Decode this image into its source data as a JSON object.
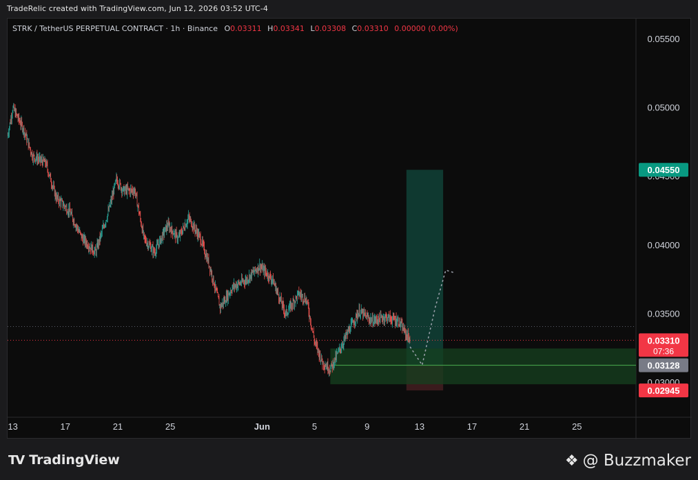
{
  "header": {
    "credit": "TradeRelic created with TradingView.com, Jun 12, 2026 03:52 UTC-4"
  },
  "legend": {
    "symbol": "STRK / TetherUS PERPETUAL CONTRACT · 1h · Binance",
    "o_label": "O",
    "o_value": "0.03311",
    "h_label": "H",
    "h_value": "0.03341",
    "l_label": "L",
    "l_value": "0.03308",
    "c_label": "C",
    "c_value": "0.03310",
    "change": "0.00000 (0.00%)"
  },
  "footer": {
    "brand_mark": "TV",
    "brand": "TradingView",
    "author": "@ Buzzmaker"
  },
  "colors": {
    "up": "#26a69a",
    "down": "#ef5350",
    "target_fill": "#103c33",
    "stop_fill": "#3d1c1f",
    "entry_zone": "#16401f",
    "current_price": "#f23645",
    "target_label": "#089981",
    "entry_label": "#787b86"
  },
  "chart_data": {
    "type": "candlestick",
    "y_axis": {
      "min": 0.0275,
      "max": 0.0565,
      "tick_labels": [
        "0.05500",
        "0.05000",
        "0.04500",
        "0.04000",
        "0.03500",
        "0.03000"
      ]
    },
    "x_axis": {
      "tick_labels": [
        "13",
        "17",
        "21",
        "25",
        "Jun",
        "5",
        "9",
        "13",
        "17",
        "21",
        "25"
      ],
      "tick_days": [
        13,
        17,
        21,
        25,
        32,
        36,
        40,
        44,
        48,
        52,
        56
      ],
      "start_day": 12.6,
      "end_day": 60.5
    },
    "price_path": [
      [
        12.6,
        0.048
      ],
      [
        13.0,
        0.05
      ],
      [
        13.8,
        0.0485
      ],
      [
        14.5,
        0.0465
      ],
      [
        15.5,
        0.046
      ],
      [
        16.3,
        0.0435
      ],
      [
        17.3,
        0.0425
      ],
      [
        18.3,
        0.0405
      ],
      [
        19.3,
        0.0395
      ],
      [
        20.3,
        0.0425
      ],
      [
        20.9,
        0.0448
      ],
      [
        21.4,
        0.044
      ],
      [
        22.3,
        0.044
      ],
      [
        23.0,
        0.0405
      ],
      [
        23.8,
        0.0395
      ],
      [
        24.8,
        0.0415
      ],
      [
        25.6,
        0.0405
      ],
      [
        26.4,
        0.042
      ],
      [
        27.3,
        0.0405
      ],
      [
        28.0,
        0.0385
      ],
      [
        28.8,
        0.0355
      ],
      [
        29.8,
        0.037
      ],
      [
        30.8,
        0.0375
      ],
      [
        31.8,
        0.0385
      ],
      [
        32.8,
        0.0375
      ],
      [
        33.8,
        0.035
      ],
      [
        34.8,
        0.0365
      ],
      [
        35.4,
        0.036
      ],
      [
        36.0,
        0.033
      ],
      [
        36.6,
        0.0315
      ],
      [
        37.2,
        0.031
      ],
      [
        37.8,
        0.0322
      ],
      [
        38.6,
        0.0338
      ],
      [
        39.4,
        0.0352
      ],
      [
        40.4,
        0.0345
      ],
      [
        41.4,
        0.0348
      ],
      [
        42.4,
        0.0345
      ],
      [
        43.0,
        0.0335
      ],
      [
        43.3,
        0.0331
      ]
    ],
    "current_price": 0.0331,
    "current_price_label": "0.03310",
    "countdown": "07:36",
    "entry_price": 0.03128,
    "entry_label": "0.03128",
    "target_price": 0.0455,
    "target_label": "0.04550",
    "stop_price": 0.02945,
    "stop_label": "0.02945",
    "entry_zone": [
      0.0299,
      0.0325
    ],
    "position_days": [
      43.0,
      45.8
    ],
    "projection": [
      [
        43.3,
        0.0326
      ],
      [
        44.2,
        0.0313
      ],
      [
        45.2,
        0.0355
      ],
      [
        46.0,
        0.0382
      ],
      [
        46.7,
        0.038
      ]
    ]
  }
}
